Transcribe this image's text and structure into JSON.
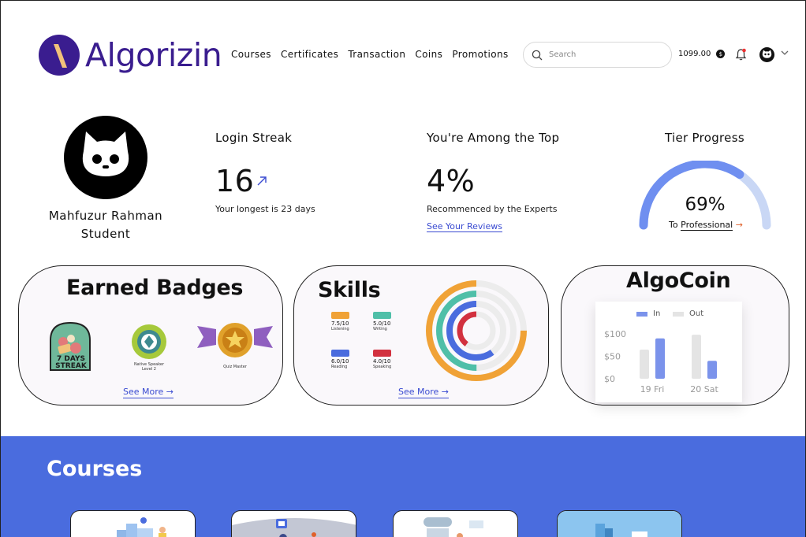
{
  "brand": {
    "name": "Algorizin",
    "color": "#3a1d8f"
  },
  "nav": [
    "Courses",
    "Certificates",
    "Transaction",
    "Coins",
    "Promotions"
  ],
  "search": {
    "placeholder": "Search"
  },
  "wallet": {
    "balance": "1099.00",
    "coin_symbol": "$"
  },
  "profile": {
    "name": "Mahfuzur Rahman",
    "role": "Student"
  },
  "login_streak": {
    "title": "Login Streak",
    "value": "16",
    "subtitle": "Your longest is 23 days"
  },
  "ranking": {
    "title": "You're Among the Top",
    "value": "4%",
    "subtitle": "Recommenced by the Experts",
    "link": "See Your Reviews"
  },
  "tier": {
    "title": "Tier Progress",
    "percent_label": "69%",
    "progress": 0.69,
    "to_prefix": "To",
    "next_tier": "Professional",
    "arrow": "→"
  },
  "badges": {
    "title": "Earned Badges",
    "items": [
      {
        "name": "7 Days Streak",
        "label_line1": "7 DAYS",
        "label_line2": "STREAK"
      },
      {
        "name": "Native Speaker Level 2",
        "label_line1": "Native Speaker",
        "label_line2": "Level 2"
      },
      {
        "name": "Quiz Master",
        "label_line1": "Quiz Master",
        "label_line2": ""
      }
    ],
    "see_more": "See More →"
  },
  "skills": {
    "title": "Skills",
    "items": [
      {
        "name": "Listening",
        "score": "7.5/10",
        "color": "#f0a236"
      },
      {
        "name": "Writing",
        "score": "5.0/10",
        "color": "#4fbfa8"
      },
      {
        "name": "Reading",
        "score": "6.0/10",
        "color": "#4a6cde"
      },
      {
        "name": "Speaking",
        "score": "4.0/10",
        "color": "#d2313f"
      }
    ],
    "see_more": "See More →"
  },
  "algocoin": {
    "title": "AlgoCoin",
    "legend_in": "In",
    "legend_out": "Out",
    "y_labels": [
      "$100",
      "$50",
      "$0"
    ],
    "chart_data": {
      "type": "bar",
      "categories": [
        "19 Fri",
        "20 Sat"
      ],
      "series": [
        {
          "name": "In",
          "values": [
            90,
            40
          ],
          "color": "#7b93eb"
        },
        {
          "name": "Out",
          "values": [
            65,
            98
          ],
          "color": "#e4e4e4"
        }
      ],
      "ylim": [
        0,
        100
      ]
    }
  },
  "courses": {
    "title": "Courses"
  }
}
